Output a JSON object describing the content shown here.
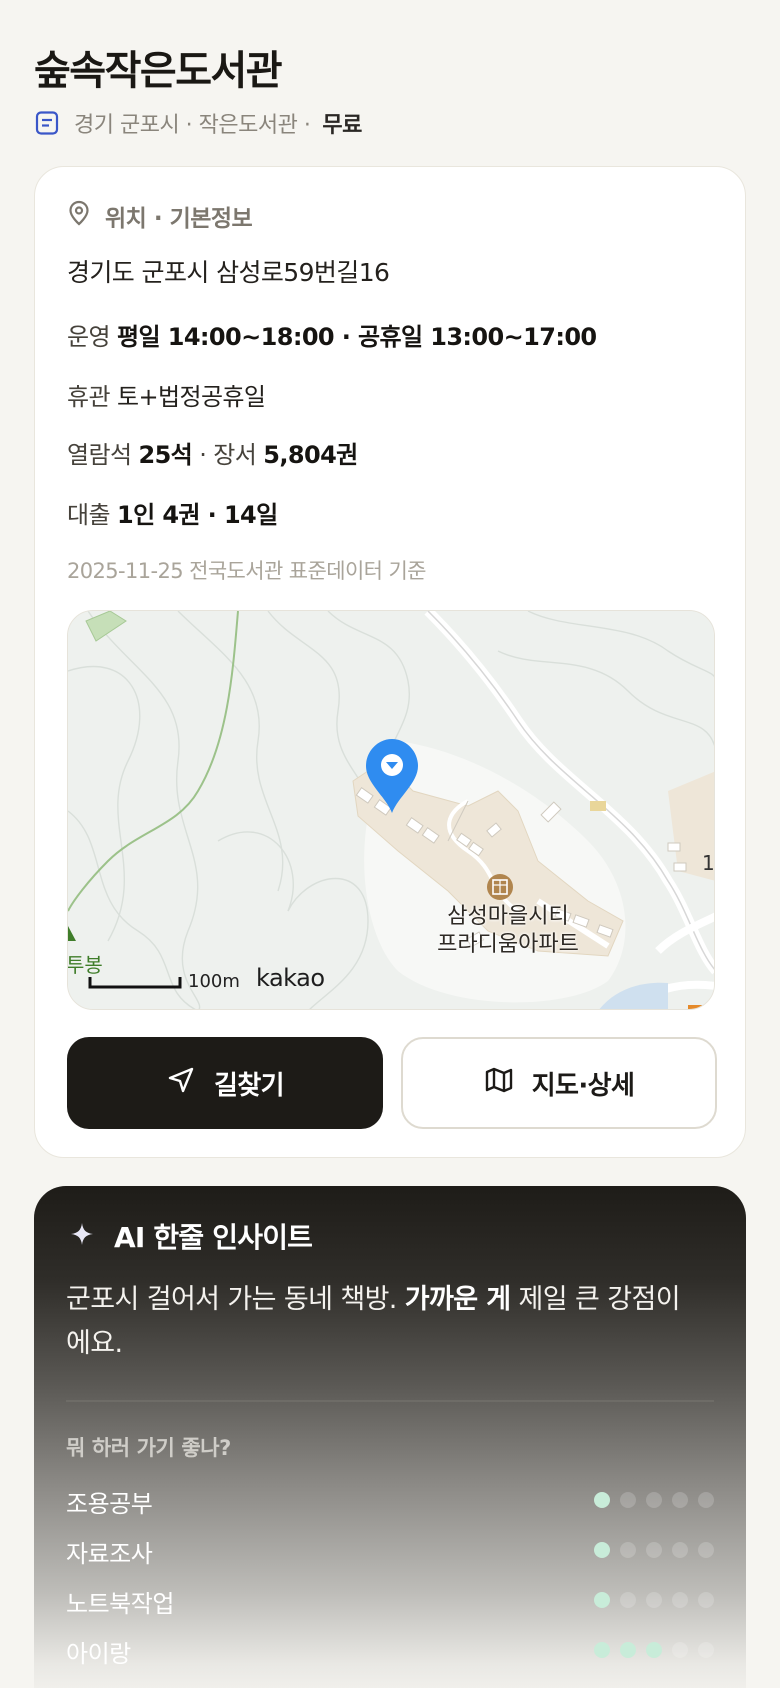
{
  "header": {
    "title": "숲속작은도서관",
    "region": "경기 군포시 · 작은도서관 ·",
    "fee": "무료"
  },
  "info": {
    "section_title": "위치 · 기본정보",
    "address": "경기도 군포시 삼성로59번길16",
    "hours_label": "운영",
    "hours_value": "평일 14:00~18:00 · 공휴일 13:00~17:00",
    "closed_label": "휴관",
    "closed_value": "토+법정공휴일",
    "seats_label": "열람석",
    "seats_value": "25석",
    "books_label": "· 장서",
    "books_value": "5,804권",
    "loan_label": "대출",
    "loan_value": "1인 4권 · 14일",
    "source": "2025-11-25 전국도서관 표준데이터 기준"
  },
  "map": {
    "place_label_1": "삼성마을시티",
    "place_label_2": "프라디움아파트",
    "hill_label": "투봉",
    "scale_label": "100m",
    "provider": "kakao",
    "edge_number": "1",
    "pin_color": "#2f8cf0"
  },
  "actions": {
    "directions_label": "길찾기",
    "map_detail_label": "지도·상세"
  },
  "ai": {
    "title": "AI 한줄 인사이트",
    "text_before": "군포시 걸어서 가는 동네 책방. ",
    "text_bold": "가까운 게",
    "text_after": " 제일 큰 강점이에요.",
    "question": "뭐 하러 가기 좋나?",
    "ratings": [
      {
        "label": "조용공부",
        "score": 1,
        "max": 5
      },
      {
        "label": "자료조사",
        "score": 1,
        "max": 5
      },
      {
        "label": "노트북작업",
        "score": 1,
        "max": 5
      },
      {
        "label": "아이랑",
        "score": 3,
        "max": 5
      }
    ]
  }
}
